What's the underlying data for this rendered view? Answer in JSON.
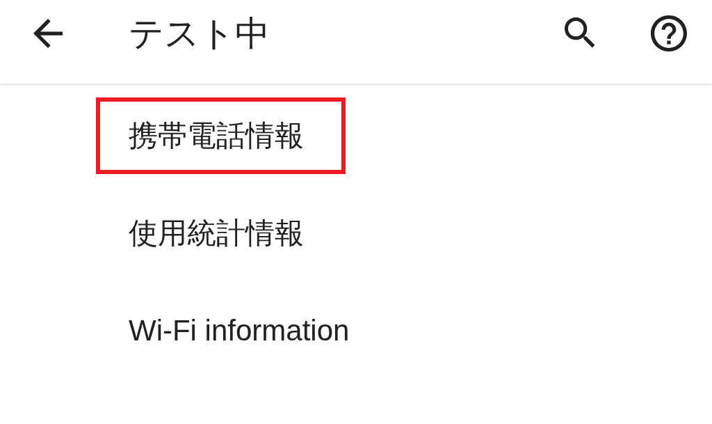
{
  "app_bar": {
    "title": "テスト中"
  },
  "items": [
    {
      "label": "携帯電話情報",
      "highlighted": true
    },
    {
      "label": "使用統計情報",
      "highlighted": false
    },
    {
      "label": "Wi-Fi information",
      "highlighted": false
    }
  ]
}
